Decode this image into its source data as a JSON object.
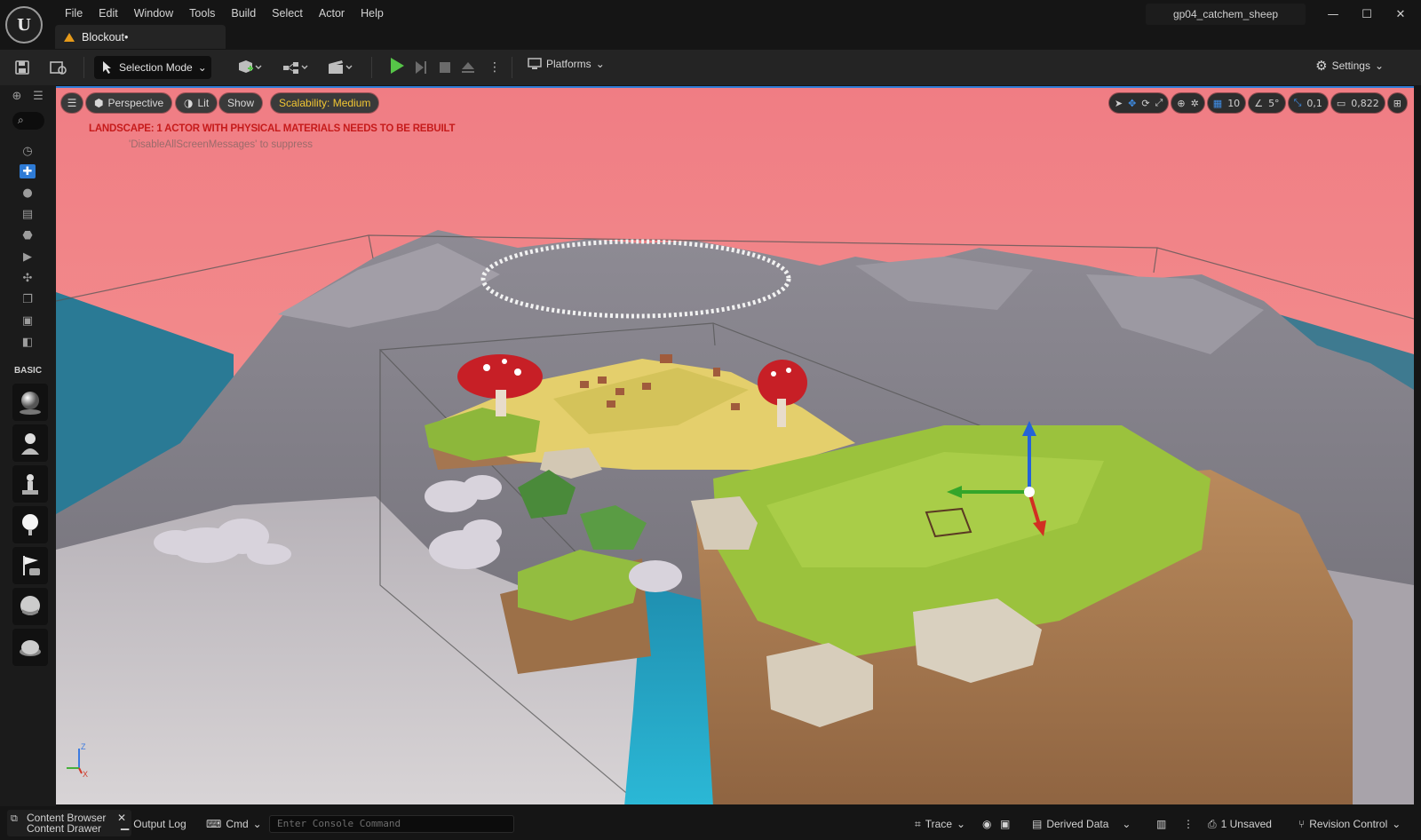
{
  "titlebar": {
    "logo_text": "U",
    "menu": [
      "File",
      "Edit",
      "Window",
      "Tools",
      "Build",
      "Select",
      "Actor",
      "Help"
    ],
    "level_tab": "Blockout•",
    "project_name": "gp04_catchem_sheep",
    "window_controls": [
      "—",
      "☐",
      "✕"
    ]
  },
  "toolbar": {
    "selection_mode": "Selection Mode",
    "platforms": "Platforms",
    "settings": "Settings"
  },
  "leftbar": {
    "basic_label": "BASIC"
  },
  "viewport": {
    "perspective": "Perspective",
    "lit": "Lit",
    "show": "Show",
    "scalability": "Scalability: Medium",
    "warning": "LANDSCAPE: 1 ACTOR WITH PHYSICAL MATERIALS NEEDS TO BE REBUILT",
    "suppress": "'DisableAllScreenMessages' to suppress",
    "grid_snap": "10",
    "rotation_snap": "5°",
    "scale_snap": "0,1",
    "camera_speed": "0,822",
    "axis_z": "Z",
    "axis_x": "X",
    "accent_color": "#2e7bd6",
    "sky_color": "#f3868a"
  },
  "statusbar": {
    "content_browser": "Content Browser",
    "content_drawer": "Content Drawer",
    "output_log": "Output Log",
    "cmd": "Cmd",
    "console_placeholder": "Enter Console Command",
    "trace": "Trace",
    "derived_data": "Derived Data",
    "unsaved": "1 Unsaved",
    "revision_control": "Revision Control"
  }
}
